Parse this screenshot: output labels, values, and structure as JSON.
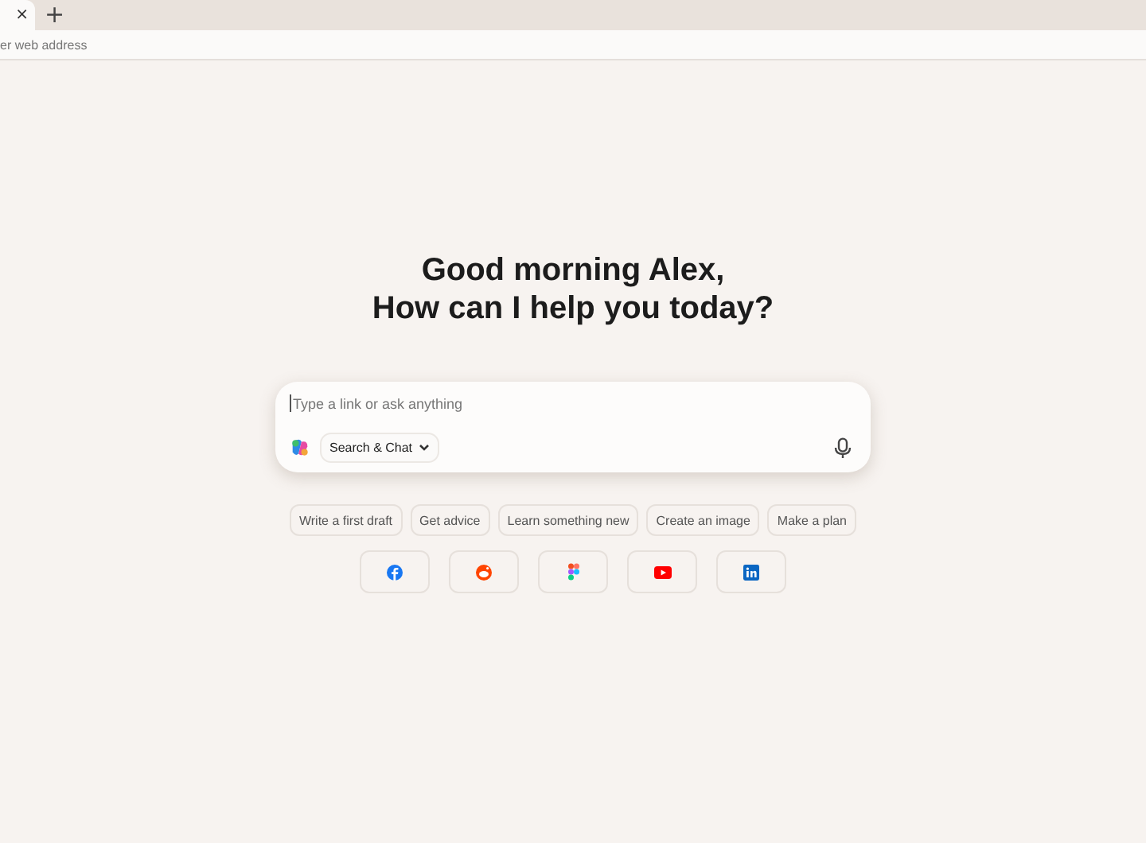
{
  "tab": {
    "close": "×"
  },
  "new_tab": "+",
  "address_bar": {
    "placeholder": "er web address"
  },
  "greeting": [
    "Good morning Alex,",
    "How can I help you today?"
  ],
  "composer": {
    "placeholder": "Type a link or ask anything",
    "mode": "Search & Chat"
  },
  "suggestions": [
    "Write a first draft",
    "Get advice",
    "Learn something new",
    "Create an image",
    "Make a plan"
  ],
  "shortcuts": [
    {
      "kind": "f"
    },
    {
      "kind": "r"
    },
    {
      "kind": "g"
    },
    {
      "kind": "y"
    },
    {
      "kind": "l"
    }
  ]
}
